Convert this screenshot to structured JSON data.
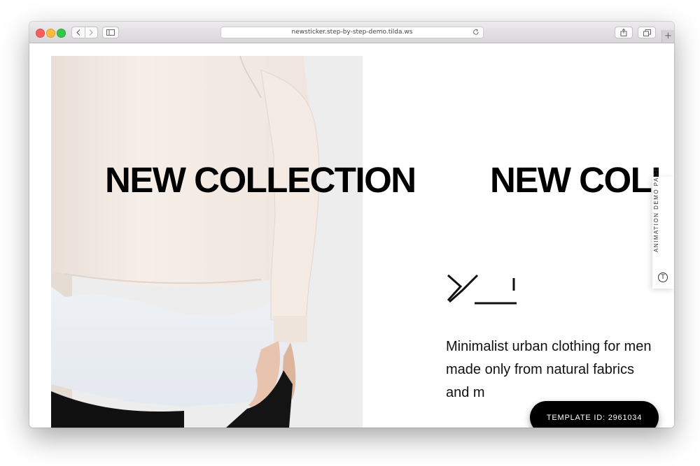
{
  "browser": {
    "url": "newsticker.step-by-step-demo.tilda.ws",
    "icons": [
      "back-icon",
      "forward-icon",
      "sidebar-icon",
      "reload-icon",
      "share-icon",
      "tabs-icon"
    ],
    "new_tab_label": "+"
  },
  "page": {
    "headline_1": "NEW COLLECTION",
    "headline_2": "NEW COLL",
    "tagline": "Minimalist urban clothing for men made only from natural fabrics and m",
    "side_tab": {
      "label": "ANIMATION DEMO PAGE",
      "icon": "tilda-logo-icon",
      "icon_glyph": "T"
    },
    "template_badge": "TEMPLATE ID: 2961034"
  },
  "colors": {
    "traffic_red": "#fc605c",
    "traffic_yellow": "#fdbc40",
    "traffic_green": "#34c84a",
    "text": "#000000",
    "badge_bg": "#000000",
    "badge_text": "#ffffff"
  }
}
